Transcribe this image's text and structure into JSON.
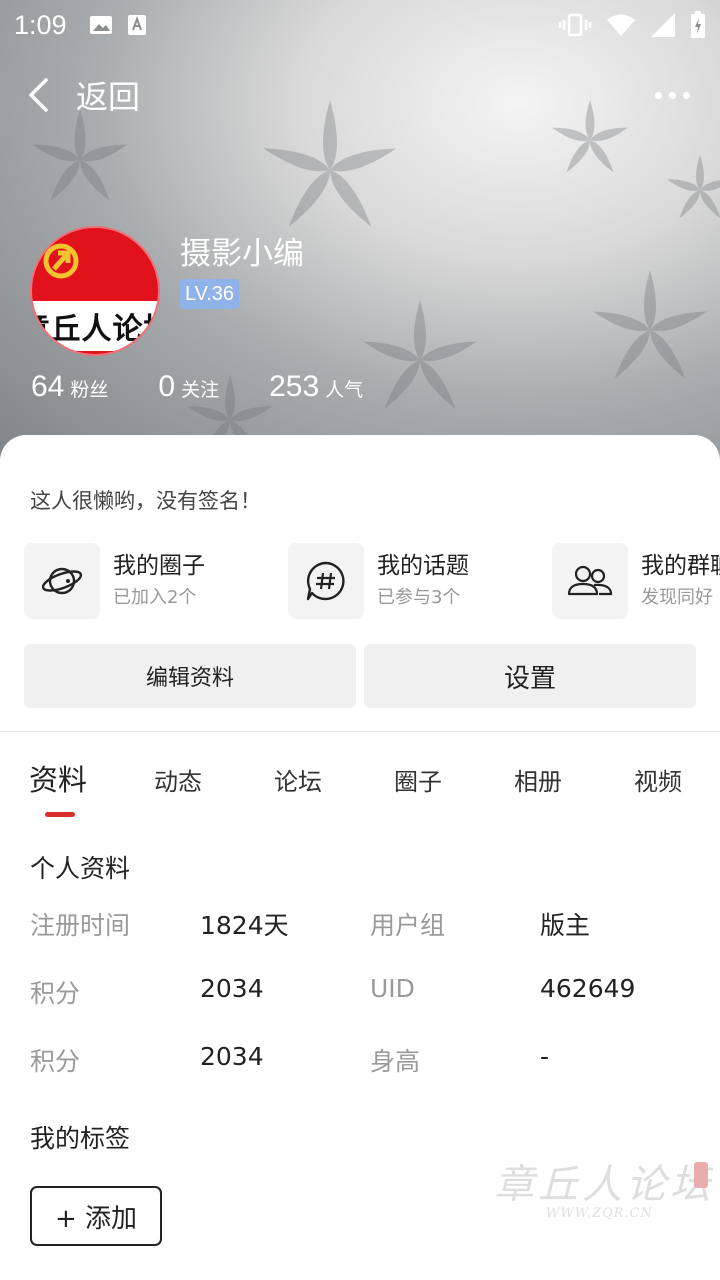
{
  "status_bar": {
    "time": "1:09"
  },
  "header": {
    "back_label": "返回"
  },
  "profile": {
    "avatar_text": "章丘人论坛",
    "name": "摄影小编",
    "level": "LV.36",
    "stats": [
      {
        "num": "64",
        "label": "粉丝"
      },
      {
        "num": "0",
        "label": "关注"
      },
      {
        "num": "253",
        "label": "人气"
      }
    ],
    "signature": "这人很懒哟，没有签名！"
  },
  "features": [
    {
      "icon": "planet-icon",
      "title": "我的圈子",
      "sub": "已加入2个"
    },
    {
      "icon": "hashtag-chat-icon",
      "title": "我的话题",
      "sub": "已参与3个"
    },
    {
      "icon": "group-icon",
      "title": "我的群聊",
      "sub": "发现同好"
    }
  ],
  "actions": {
    "edit": "编辑资料",
    "settings": "设置"
  },
  "tabs": [
    "资料",
    "动态",
    "论坛",
    "圈子",
    "相册",
    "视频"
  ],
  "info": {
    "title": "个人资料",
    "rows": [
      [
        {
          "label": "注册时间",
          "value": "1824天"
        },
        {
          "label": "用户组",
          "value": "版主"
        }
      ],
      [
        {
          "label": "积分",
          "value": "2034"
        },
        {
          "label": "UID",
          "value": "462649"
        }
      ],
      [
        {
          "label": "积分",
          "value": "2034"
        },
        {
          "label": "身高",
          "value": "-"
        }
      ]
    ]
  },
  "tags": {
    "title": "我的标签",
    "add_label": "+ 添加"
  },
  "watermark": {
    "text": "章丘人论坛",
    "url": "WWW.ZQR.CN"
  },
  "colors": {
    "accent": "#d9302c",
    "level_badge": "#8fb3e8",
    "avatar_red": "#e2121d"
  }
}
